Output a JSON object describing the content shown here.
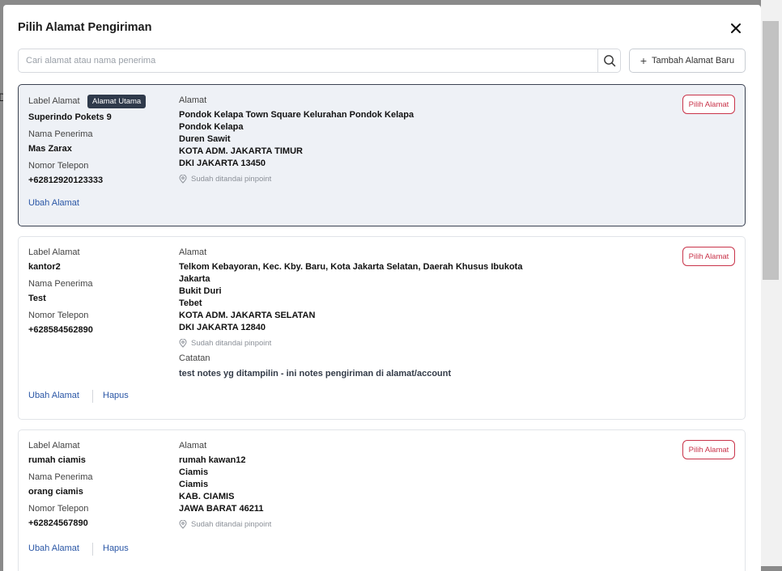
{
  "modal": {
    "title": "Pilih Alamat Pengiriman"
  },
  "search": {
    "placeholder": "Cari alamat atau nama penerima"
  },
  "add_button": {
    "label": "Tambah Alamat Baru"
  },
  "field_labels": {
    "label": "Label Alamat",
    "recipient": "Nama Penerima",
    "phone": "Nomor Telepon",
    "address": "Alamat",
    "notes": "Catatan"
  },
  "pinpoint_text": "Sudah ditandai pinpoint",
  "pick_label": "Pilih Alamat",
  "edit_label": "Ubah Alamat",
  "delete_label": "Hapus",
  "addresses": [
    {
      "label": "Superindo Pokets 9",
      "badge": "Alamat Utama",
      "recipient": "Mas Zarax",
      "phone": "+62812920123333",
      "address_lines": [
        "Pondok Kelapa Town Square Kelurahan Pondok Kelapa",
        "Pondok Kelapa",
        "Duren Sawit",
        "KOTA ADM. JAKARTA TIMUR",
        "DKI JAKARTA 13450"
      ]
    },
    {
      "label": "kantor2",
      "recipient": "Test",
      "phone": "+628584562890",
      "address_lines": [
        "Telkom Kebayoran, Kec. Kby. Baru, Kota Jakarta Selatan, Daerah Khusus Ibukota",
        "Jakarta",
        "Bukit Duri",
        "Tebet",
        "KOTA ADM. JAKARTA SELATAN",
        "DKI JAKARTA 12840"
      ],
      "notes": "test notes yg ditampilin - ini notes pengiriman di alamat/account"
    },
    {
      "label": "rumah ciamis",
      "recipient": "orang ciamis",
      "phone": "+62824567890",
      "address_lines": [
        "rumah kawan12",
        "Ciamis",
        "Ciamis",
        "KAB. CIAMIS",
        "JAWA BARAT 46211"
      ]
    }
  ],
  "backdrop_fragment": "D"
}
